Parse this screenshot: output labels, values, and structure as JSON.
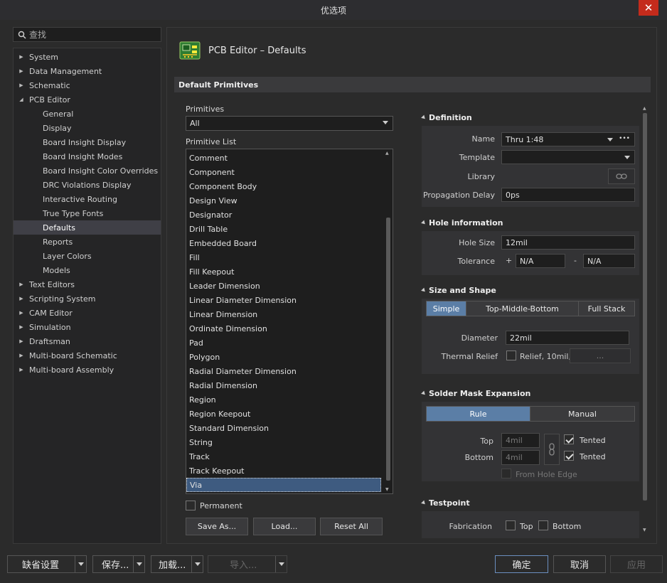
{
  "window": {
    "title": "优选项",
    "close": "✕"
  },
  "search": {
    "placeholder": "查找"
  },
  "tree": {
    "system": "System",
    "data_management": "Data Management",
    "schematic": "Schematic",
    "pcb_editor": "PCB Editor",
    "pcb_children": [
      "General",
      "Display",
      "Board Insight Display",
      "Board Insight Modes",
      "Board Insight Color Overrides",
      "DRC Violations Display",
      "Interactive Routing",
      "True Type Fonts",
      "Defaults",
      "Reports",
      "Layer Colors",
      "Models"
    ],
    "text_editors": "Text Editors",
    "scripting_system": "Scripting System",
    "cam_editor": "CAM Editor",
    "simulation": "Simulation",
    "draftsman": "Draftsman",
    "multiboard_schematic": "Multi-board Schematic",
    "multiboard_assembly": "Multi-board Assembly"
  },
  "page": {
    "title": "PCB Editor – Defaults",
    "section": "Default Primitives"
  },
  "primitives": {
    "label": "Primitives",
    "selected": "All",
    "list_label": "Primitive List",
    "items": [
      "Comment",
      "Component",
      "Component Body",
      "Design View",
      "Designator",
      "Drill Table",
      "Embedded Board",
      "Fill",
      "Fill Keepout",
      "Leader Dimension",
      "Linear Diameter Dimension",
      "Linear Dimension",
      "Ordinate Dimension",
      "Pad",
      "Polygon",
      "Radial Diameter Dimension",
      "Radial Dimension",
      "Region",
      "Region Keepout",
      "Standard Dimension",
      "String",
      "Track",
      "Track Keepout",
      "Via"
    ],
    "selected_item": "Via",
    "permanent": "Permanent",
    "save_as": "Save As...",
    "load": "Load...",
    "reset_all": "Reset All"
  },
  "definition": {
    "title": "Definition",
    "name_label": "Name",
    "name_value": "Thru 1:48",
    "more": "•••",
    "template_label": "Template",
    "template_value": "",
    "library_label": "Library",
    "propagation_label": "Propagation Delay",
    "propagation_value": "0ps"
  },
  "hole": {
    "title": "Hole information",
    "size_label": "Hole Size",
    "size_value": "12mil",
    "tolerance_label": "Tolerance",
    "plus": "+",
    "plus_value": "N/A",
    "minus": "-",
    "minus_value": "N/A"
  },
  "shape": {
    "title": "Size and Shape",
    "tabs": [
      "Simple",
      "Top-Middle-Bottom",
      "Full Stack"
    ],
    "diameter_label": "Diameter",
    "diameter_value": "22mil",
    "thermal_label": "Thermal Relief",
    "thermal_value": "Relief, 10mil,",
    "thermal_more": "..."
  },
  "solder": {
    "title": "Solder Mask Expansion",
    "tabs": [
      "Rule",
      "Manual"
    ],
    "top_label": "Top",
    "top_value": "4mil",
    "bottom_label": "Bottom",
    "bottom_value": "4mil",
    "tented": "Tented",
    "from_hole_edge": "From Hole Edge"
  },
  "testpoint": {
    "title": "Testpoint",
    "fabrication": "Fabrication",
    "top": "Top",
    "bottom": "Bottom"
  },
  "footer": {
    "default_settings": "缺省设置",
    "save": "保存...",
    "load": "加载...",
    "import": "导入...",
    "ok": "确定",
    "cancel": "取消",
    "apply": "应用"
  },
  "colors": {
    "accent": "#5b7ea6",
    "close": "#c42b1c",
    "selection": "#3e5b80"
  }
}
